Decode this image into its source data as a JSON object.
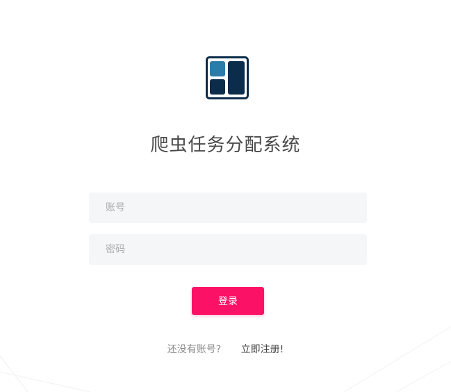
{
  "app": {
    "title": "爬虫任务分配系统",
    "logo_icon": "app-grid-logo-icon",
    "logo_colors": [
      "#0b2c4a",
      "#2a7ca9"
    ]
  },
  "login_form": {
    "username_placeholder": "账号",
    "password_placeholder": "密码",
    "username_value": "",
    "password_value": "",
    "submit_label": "登录",
    "accent_color": "#fb1266"
  },
  "footer": {
    "no_account_text": "还没有账号?",
    "register_link": "立即注册!"
  }
}
